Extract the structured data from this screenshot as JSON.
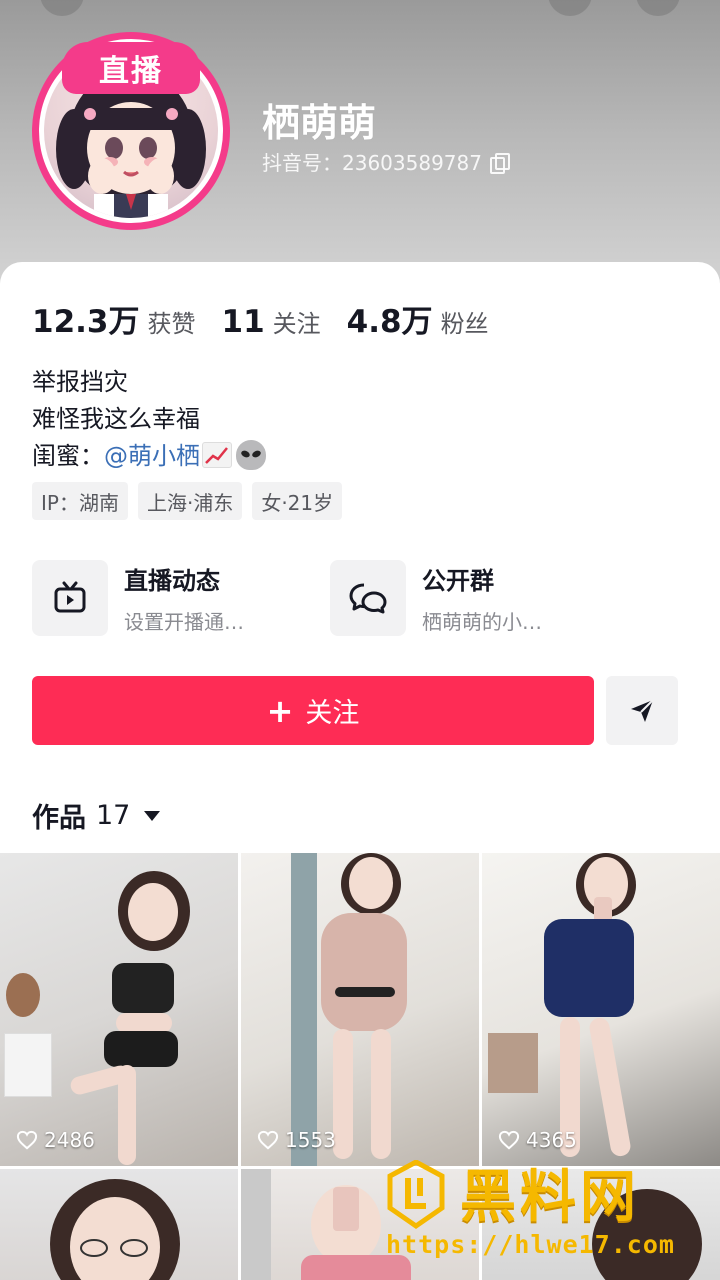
{
  "profile": {
    "live_badge": "直播",
    "nickname": "栖萌萌",
    "uid": "抖音号：23603589787"
  },
  "stats": [
    {
      "value": "12.3万",
      "label": "获赞"
    },
    {
      "value": "11",
      "label": "关注"
    },
    {
      "value": "4.8万",
      "label": "粉丝"
    }
  ],
  "bio": {
    "line1": "举报挡灾",
    "line2": "难怪我这么幸福",
    "line3_prefix": "闺蜜：",
    "line3_mention": "@萌小栖"
  },
  "tags": [
    "IP：湖南",
    "上海·浦东",
    "女·21岁"
  ],
  "entries": [
    {
      "title": "直播动态",
      "subtitle": "设置开播通…",
      "icon": "tv-icon"
    },
    {
      "title": "公开群",
      "subtitle": "栖萌萌的小…",
      "icon": "group-chat-icon"
    }
  ],
  "actions": {
    "follow_plus": "+",
    "follow_label": "关注",
    "share_icon": "send-icon"
  },
  "works": {
    "label": "作品",
    "count": "17"
  },
  "videos": [
    {
      "likes": "2486"
    },
    {
      "likes": "1553"
    },
    {
      "likes": "4365"
    },
    {
      "likes": ""
    },
    {
      "likes": ""
    },
    {
      "likes": ""
    }
  ],
  "watermark": {
    "title": "黑料网",
    "url": "https://hlwe17.com"
  },
  "colors": {
    "accent": "#fe2c55",
    "live": "#f43b8a",
    "mention": "#3b6fb6",
    "watermark": "#f5b800"
  }
}
